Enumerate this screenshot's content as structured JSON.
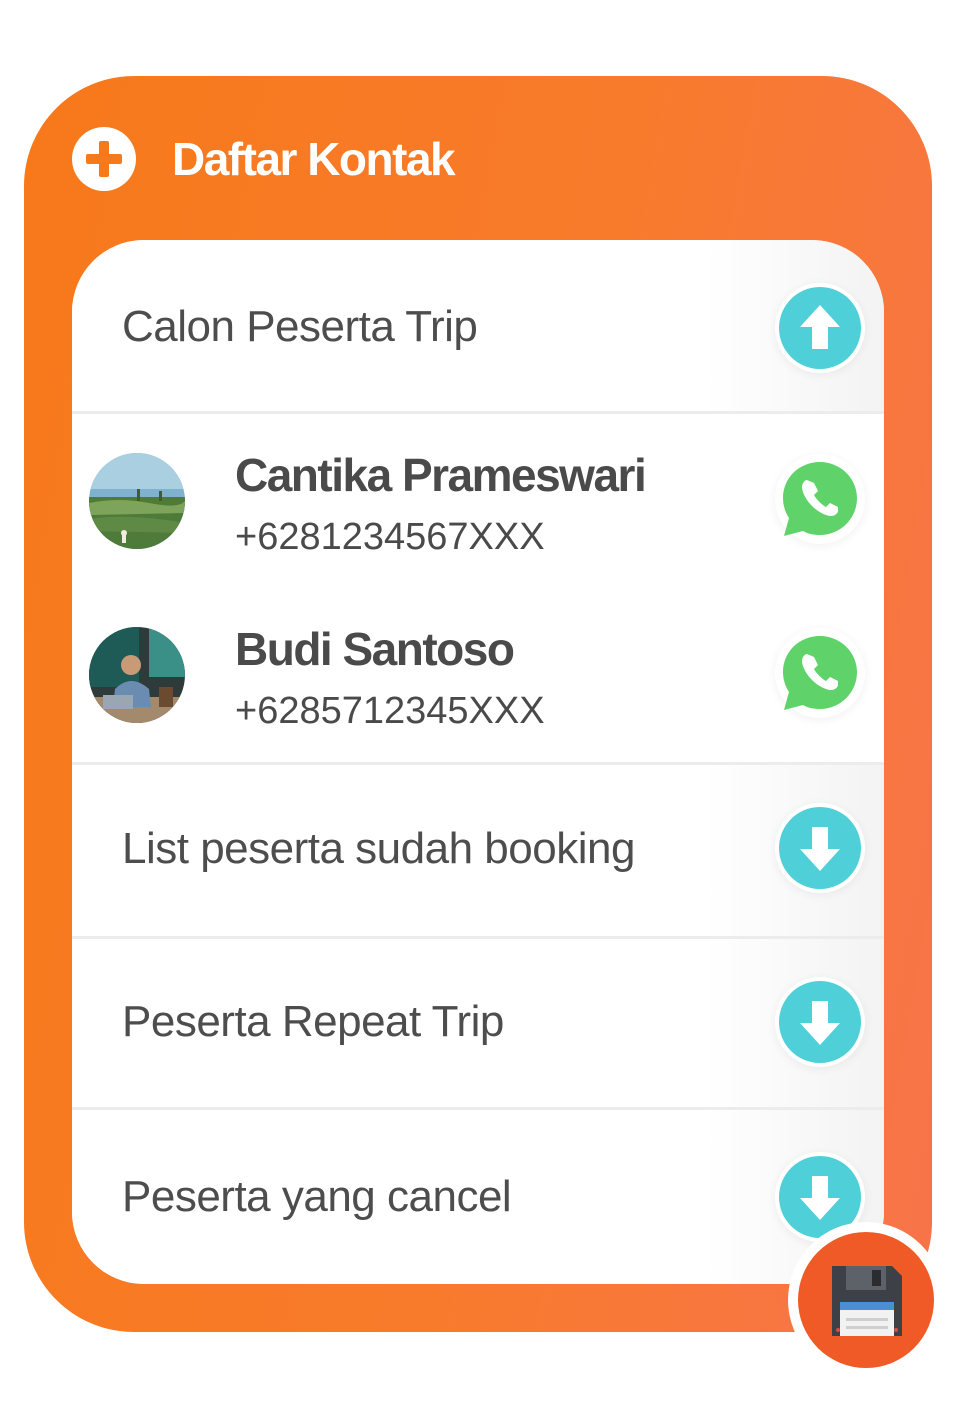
{
  "header": {
    "title": "Daftar Kontak",
    "add_icon": "plus-circle-icon"
  },
  "sections": {
    "calon": {
      "label": "Calon Peserta Trip",
      "toggle_icon": "arrow-up-icon",
      "expanded": true
    },
    "booking": {
      "label": "List peserta sudah booking",
      "toggle_icon": "arrow-down-icon",
      "expanded": false
    },
    "repeat": {
      "label": "Peserta Repeat Trip",
      "toggle_icon": "arrow-down-icon",
      "expanded": false
    },
    "cancel": {
      "label": "Peserta yang cancel",
      "toggle_icon": "arrow-down-icon",
      "expanded": false
    }
  },
  "contacts": [
    {
      "name": "Cantika Prameswari",
      "phone": "+6281234567XXX",
      "action_icon": "whatsapp-icon"
    },
    {
      "name": "Budi Santoso",
      "phone": "+6285712345XXX",
      "action_icon": "whatsapp-icon"
    }
  ],
  "save": {
    "icon": "floppy-disk-icon"
  },
  "colors": {
    "accent": "#f7791a",
    "toggle": "#4fcfd8",
    "whatsapp": "#5fd26a",
    "save": "#ef5a26",
    "text": "#4a4a4a"
  }
}
